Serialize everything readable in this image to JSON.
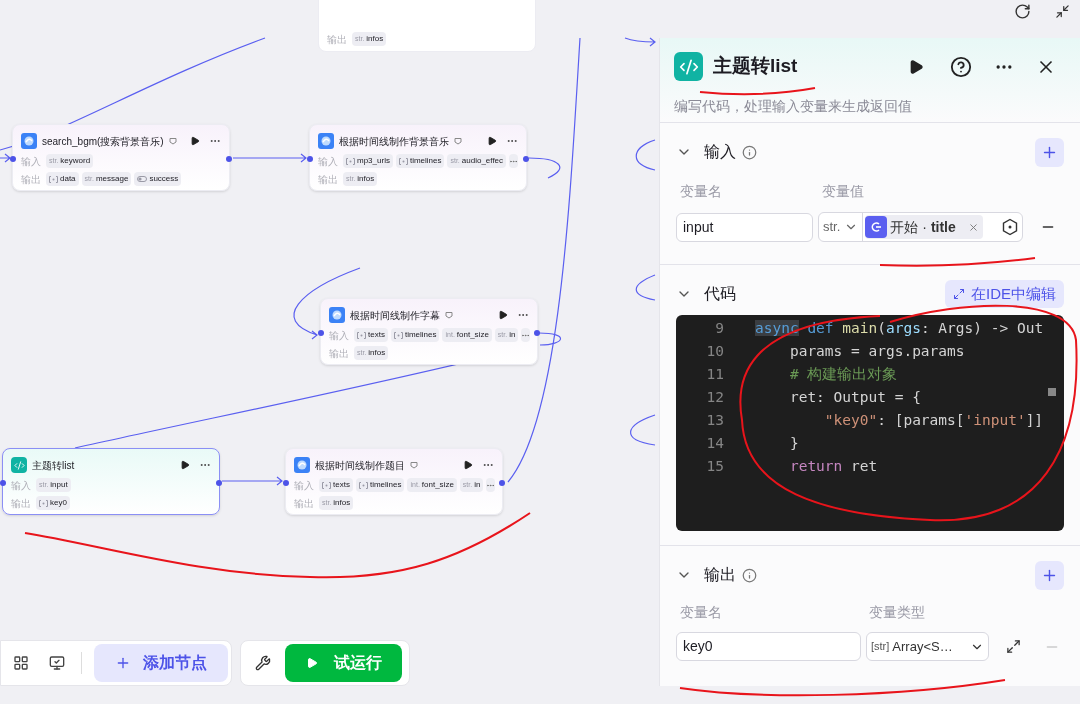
{
  "canvas": {
    "clipped_node": {
      "output_label": "输出",
      "outputs": [
        {
          "kind": "text",
          "type_label": "str.",
          "name": "infos"
        }
      ]
    },
    "nodes": [
      {
        "title": "search_bgm(搜索背景音乐)",
        "kind": "plugin",
        "selected": false,
        "has_badge": true,
        "input_label": "输入",
        "output_label": "输出",
        "more_inputs": false,
        "inputs": [
          {
            "kind": "text",
            "type_label": "str.",
            "name": "keyword"
          }
        ],
        "outputs": [
          {
            "kind": "array",
            "name": "data"
          },
          {
            "kind": "text",
            "type_label": "str.",
            "name": "message"
          },
          {
            "kind": "bool",
            "name": "success"
          }
        ]
      },
      {
        "title": "根据时间线制作背景音乐",
        "kind": "plugin",
        "selected": false,
        "has_badge": true,
        "input_label": "输入",
        "output_label": "输出",
        "more_inputs": true,
        "inputs": [
          {
            "kind": "array",
            "name": "mp3_urls"
          },
          {
            "kind": "array",
            "name": "timelines"
          },
          {
            "kind": "text",
            "type_label": "str.",
            "name": "audio_effec"
          }
        ],
        "outputs": [
          {
            "kind": "text",
            "type_label": "str.",
            "name": "infos"
          }
        ]
      },
      {
        "title": "根据时间线制作字幕",
        "kind": "plugin",
        "selected": false,
        "has_badge": true,
        "input_label": "输入",
        "output_label": "输出",
        "more_inputs": true,
        "inputs": [
          {
            "kind": "array",
            "name": "texts"
          },
          {
            "kind": "array",
            "name": "timelines"
          },
          {
            "kind": "text",
            "type_label": "int.",
            "name": "font_size"
          },
          {
            "kind": "text",
            "type_label": "str.",
            "name": "in"
          }
        ],
        "outputs": [
          {
            "kind": "text",
            "type_label": "str.",
            "name": "infos"
          }
        ]
      },
      {
        "title": "主题转list",
        "kind": "code",
        "selected": true,
        "has_badge": false,
        "input_label": "输入",
        "output_label": "输出",
        "more_inputs": false,
        "inputs": [
          {
            "kind": "text",
            "type_label": "str.",
            "name": "input"
          }
        ],
        "outputs": [
          {
            "kind": "array",
            "name": "key0"
          }
        ]
      },
      {
        "title": "根据时间线制作题目",
        "kind": "plugin",
        "selected": false,
        "has_badge": true,
        "input_label": "输入",
        "output_label": "输出",
        "more_inputs": true,
        "inputs": [
          {
            "kind": "array",
            "name": "texts"
          },
          {
            "kind": "array",
            "name": "timelines"
          },
          {
            "kind": "text",
            "type_label": "int.",
            "name": "font_size"
          },
          {
            "kind": "text",
            "type_label": "str.",
            "name": "in"
          }
        ],
        "outputs": [
          {
            "kind": "text",
            "type_label": "str.",
            "name": "infos"
          }
        ]
      }
    ]
  },
  "toolbar": {
    "add_node": "添加节点",
    "run": "试运行"
  },
  "panel": {
    "title": "主题转list",
    "description": "编写代码，处理输入变量来生成返回值",
    "input_section": {
      "title": "输入",
      "expanded": true,
      "col_name": "变量名",
      "col_value": "变量值",
      "rows": [
        {
          "name": "input",
          "type": "str.",
          "ref_node": "开始",
          "ref_sep": "·",
          "ref_field": "title"
        }
      ]
    },
    "code_section": {
      "title": "代码",
      "expanded": true,
      "ide_button": "在IDE中编辑",
      "lines": [
        {
          "number": "9",
          "tokens": [
            {
              "text": "async",
              "kind": "keyword_selected"
            },
            {
              "text": " def ",
              "kind": "keyword"
            },
            {
              "text": "main",
              "kind": "function"
            },
            {
              "text": "(",
              "kind": "plain"
            },
            {
              "text": "args",
              "kind": "param"
            },
            {
              "text": ": Args) -> Out",
              "kind": "plain"
            }
          ]
        },
        {
          "number": "10",
          "tokens": [
            {
              "text": "    params = args.params",
              "kind": "plain"
            }
          ]
        },
        {
          "number": "11",
          "tokens": [
            {
              "text": "    # 构建输出对象",
              "kind": "comment"
            }
          ]
        },
        {
          "number": "12",
          "tokens": [
            {
              "text": "    ret: Output = {",
              "kind": "plain"
            }
          ]
        },
        {
          "number": "13",
          "tokens": [
            {
              "text": "        \"key0\"",
              "kind": "string"
            },
            {
              "text": ": [params[",
              "kind": "plain"
            },
            {
              "text": "'input'",
              "kind": "string"
            },
            {
              "text": "]]",
              "kind": "plain"
            }
          ]
        },
        {
          "number": "14",
          "tokens": [
            {
              "text": "    }",
              "kind": "plain"
            }
          ]
        },
        {
          "number": "15",
          "tokens": [
            {
              "text": "    return",
              "kind": "control"
            },
            {
              "text": " ret",
              "kind": "plain"
            }
          ]
        }
      ]
    },
    "output_section": {
      "title": "输出",
      "expanded": true,
      "col_name": "变量名",
      "col_type": "变量类型",
      "rows": [
        {
          "name": "key0",
          "type_prefix": "[str]",
          "type": "Array<S…"
        }
      ]
    }
  }
}
